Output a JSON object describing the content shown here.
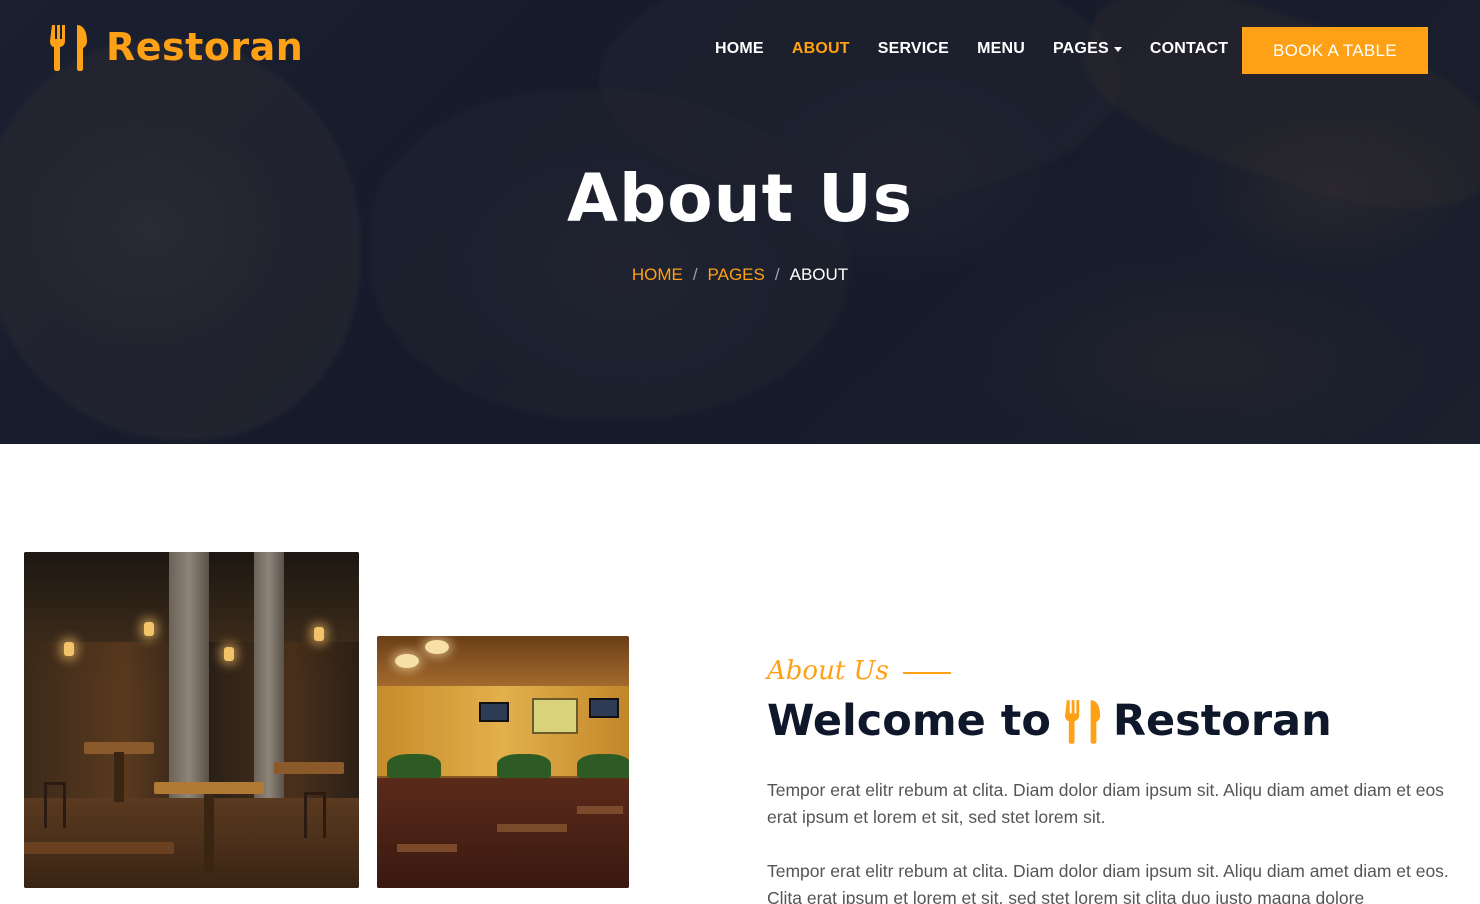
{
  "brand": {
    "name": "Restoran",
    "icon": "utensils-icon",
    "color": "#FEA116"
  },
  "nav": {
    "items": [
      {
        "label": "HOME",
        "active": false
      },
      {
        "label": "ABOUT",
        "active": true
      },
      {
        "label": "SERVICE",
        "active": false
      },
      {
        "label": "MENU",
        "active": false
      },
      {
        "label": "PAGES",
        "active": false,
        "dropdown": true
      },
      {
        "label": "CONTACT",
        "active": false
      }
    ],
    "cta_label": "BOOK A TABLE"
  },
  "hero": {
    "title": "About Us",
    "breadcrumb": [
      {
        "label": "HOME",
        "link": true
      },
      {
        "label": "PAGES",
        "link": true
      },
      {
        "label": "ABOUT",
        "link": false
      }
    ],
    "separator": "/"
  },
  "about": {
    "subtitle": "About Us",
    "heading_prefix": "Welcome to",
    "heading_brand": "Restoran",
    "paragraphs": [
      "Tempor erat elitr rebum at clita. Diam dolor diam ipsum sit. Aliqu diam amet diam et eos erat ipsum et lorem et sit, sed stet lorem sit.",
      "Tempor erat elitr rebum at clita. Diam dolor diam ipsum sit. Aliqu diam amet diam et eos. Clita erat ipsum et lorem et sit, sed stet lorem sit clita duo justo magna dolore"
    ]
  },
  "colors": {
    "accent": "#FEA116",
    "dark": "#0F172B",
    "text": "#555555"
  }
}
